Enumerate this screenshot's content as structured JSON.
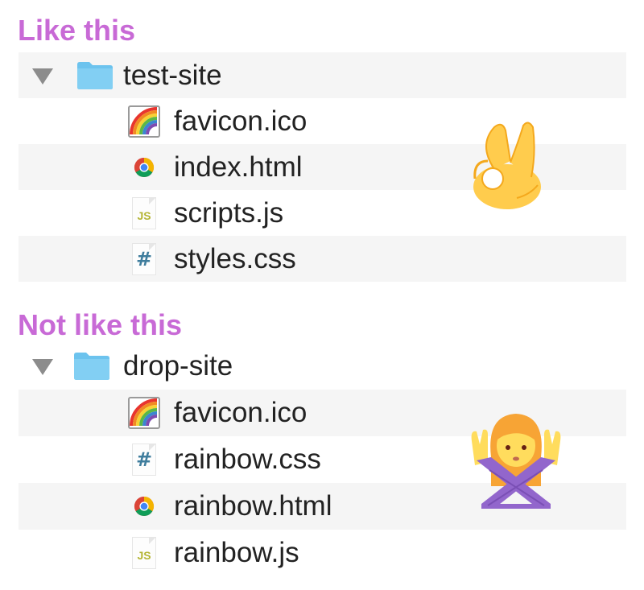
{
  "sections": [
    {
      "heading": "Like this",
      "folder": {
        "name": "test-site",
        "icon": "folder-icon"
      },
      "files": [
        {
          "name": "favicon.ico",
          "icon": "rainbow-icon"
        },
        {
          "name": "index.html",
          "icon": "chrome-icon"
        },
        {
          "name": "scripts.js",
          "icon": "js-file-icon",
          "icon_text": "JS"
        },
        {
          "name": "styles.css",
          "icon": "css-file-icon",
          "icon_text": "#"
        }
      ],
      "reaction": "ok-hand-emoji"
    },
    {
      "heading": "Not like this",
      "folder": {
        "name": "drop-site",
        "icon": "folder-icon"
      },
      "files": [
        {
          "name": "favicon.ico",
          "icon": "rainbow-icon"
        },
        {
          "name": "rainbow.css",
          "icon": "css-file-icon",
          "icon_text": "#"
        },
        {
          "name": "rainbow.html",
          "icon": "chrome-icon"
        },
        {
          "name": "rainbow.js",
          "icon": "js-file-icon",
          "icon_text": "JS"
        }
      ],
      "reaction": "no-gesture-emoji"
    }
  ],
  "colors": {
    "heading": "#c86ad6",
    "row_stripe": "#f5f5f5",
    "folder": "#6cc3ee",
    "text": "#222222"
  }
}
